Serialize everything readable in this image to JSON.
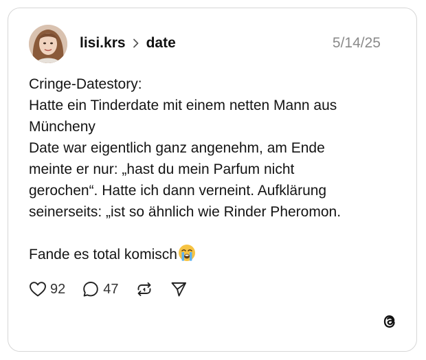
{
  "post": {
    "author": "lisi.krs",
    "topic": "date",
    "date": "5/14/25",
    "lines": [
      "Cringe-Datestory:",
      "Hatte ein Tinderdate mit einem netten Mann aus",
      "Müncheny",
      "Date war eigentlich ganz angenehm, am Ende",
      "meinte er nur: „hast du mein Parfum nicht",
      "gerochen“. Hatte ich dann verneint. Aufklärung",
      "seinerseits: „ist so ähnlich wie Rinder Pheromon."
    ],
    "closing": "Fande es total komisch",
    "closing_emoji": "loudly-crying-face-emoji"
  },
  "actions": {
    "likes": "92",
    "replies": "47",
    "repost_icon": "repost-icon",
    "share_icon": "share-icon"
  },
  "brand": {
    "logo": "threads-logo-icon"
  },
  "colors": {
    "text": "#141414",
    "muted": "#8a8a8a",
    "border": "#d6d6d6",
    "emoji": "#f6c343"
  }
}
